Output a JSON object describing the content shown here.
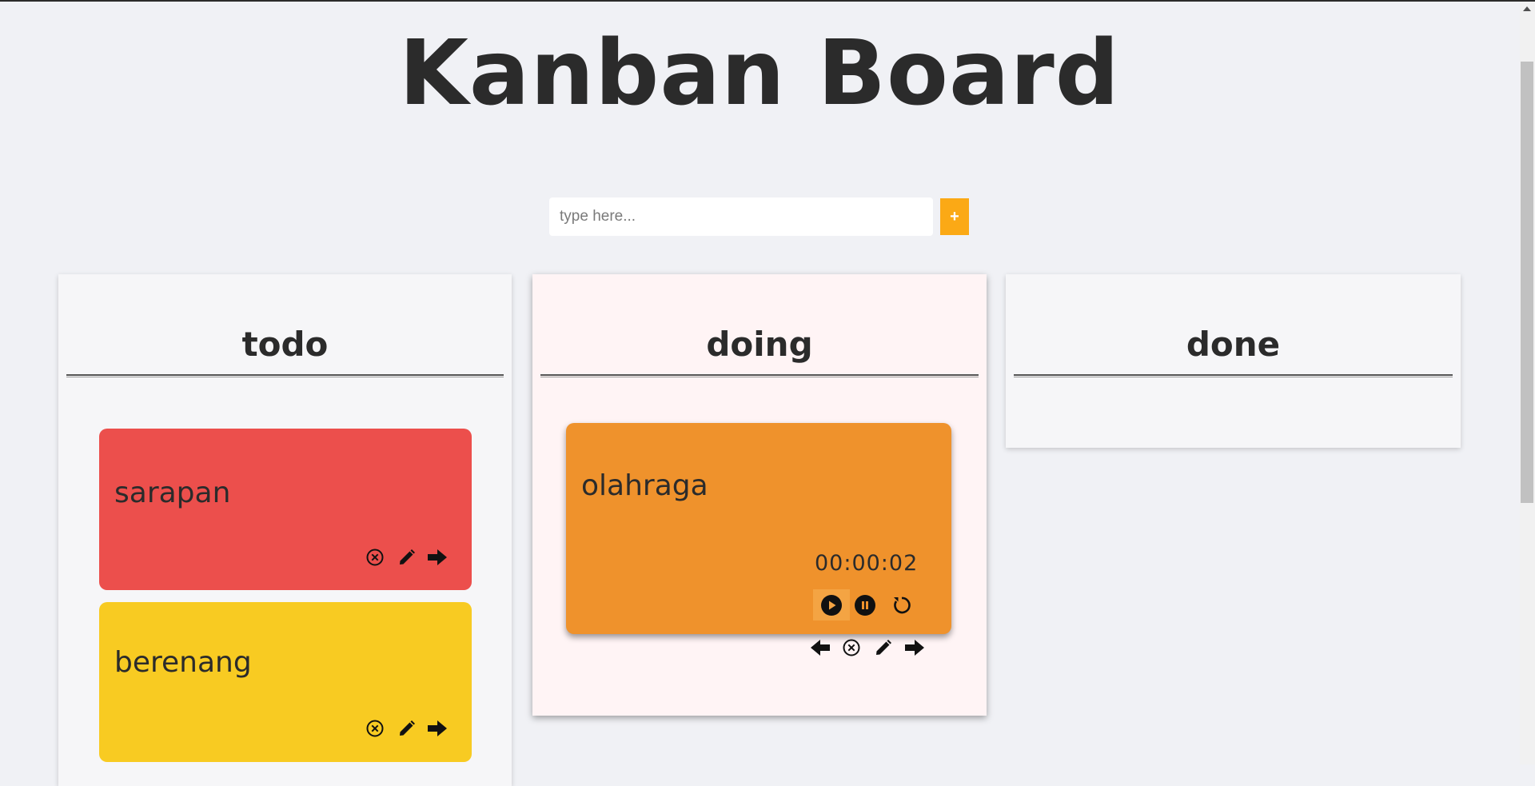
{
  "app": {
    "title": "Kanban Board"
  },
  "add_form": {
    "placeholder": "type here...",
    "add_label": "+"
  },
  "columns": [
    {
      "title": "todo",
      "cards": [
        {
          "text": "sarapan",
          "color": "#ec4f4c"
        },
        {
          "text": "berenang",
          "color": "#f8cb22"
        }
      ]
    },
    {
      "title": "doing",
      "cards": [
        {
          "text": "olahraga",
          "color": "#ef922c",
          "timer": "00:00:02"
        }
      ]
    },
    {
      "title": "done",
      "cards": []
    }
  ],
  "icons": {
    "delete": "circle-x-icon",
    "edit": "pencil-icon",
    "move_next": "arrow-right-icon",
    "move_prev": "arrow-left-icon",
    "play": "play-icon",
    "pause": "pause-icon",
    "reset": "reset-icon"
  },
  "colors": {
    "accent": "#fba915",
    "background": "#f0f1f5"
  }
}
